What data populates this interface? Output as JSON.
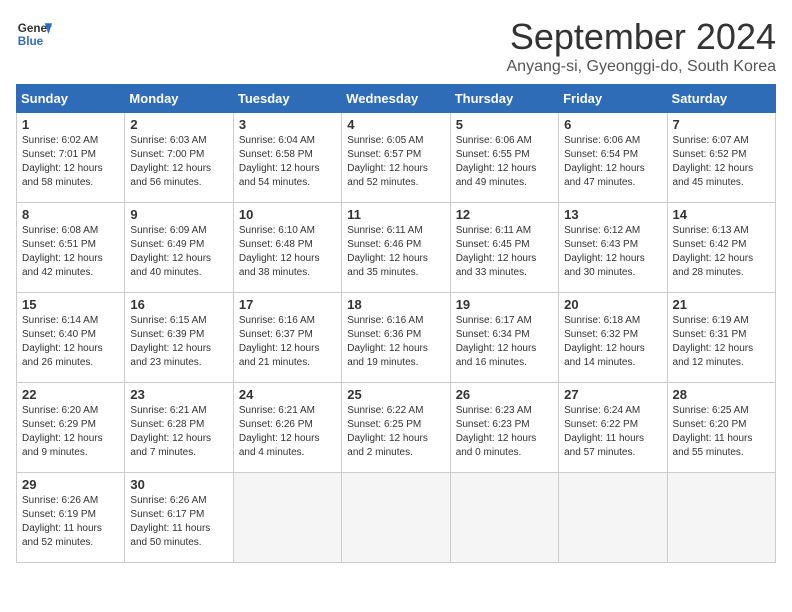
{
  "header": {
    "logo_line1": "General",
    "logo_line2": "Blue",
    "month_title": "September 2024",
    "location": "Anyang-si, Gyeonggi-do, South Korea"
  },
  "days_of_week": [
    "Sunday",
    "Monday",
    "Tuesday",
    "Wednesday",
    "Thursday",
    "Friday",
    "Saturday"
  ],
  "weeks": [
    [
      {
        "day": "1",
        "sunrise": "Sunrise: 6:02 AM",
        "sunset": "Sunset: 7:01 PM",
        "daylight": "Daylight: 12 hours and 58 minutes."
      },
      {
        "day": "2",
        "sunrise": "Sunrise: 6:03 AM",
        "sunset": "Sunset: 7:00 PM",
        "daylight": "Daylight: 12 hours and 56 minutes."
      },
      {
        "day": "3",
        "sunrise": "Sunrise: 6:04 AM",
        "sunset": "Sunset: 6:58 PM",
        "daylight": "Daylight: 12 hours and 54 minutes."
      },
      {
        "day": "4",
        "sunrise": "Sunrise: 6:05 AM",
        "sunset": "Sunset: 6:57 PM",
        "daylight": "Daylight: 12 hours and 52 minutes."
      },
      {
        "day": "5",
        "sunrise": "Sunrise: 6:06 AM",
        "sunset": "Sunset: 6:55 PM",
        "daylight": "Daylight: 12 hours and 49 minutes."
      },
      {
        "day": "6",
        "sunrise": "Sunrise: 6:06 AM",
        "sunset": "Sunset: 6:54 PM",
        "daylight": "Daylight: 12 hours and 47 minutes."
      },
      {
        "day": "7",
        "sunrise": "Sunrise: 6:07 AM",
        "sunset": "Sunset: 6:52 PM",
        "daylight": "Daylight: 12 hours and 45 minutes."
      }
    ],
    [
      {
        "day": "8",
        "sunrise": "Sunrise: 6:08 AM",
        "sunset": "Sunset: 6:51 PM",
        "daylight": "Daylight: 12 hours and 42 minutes."
      },
      {
        "day": "9",
        "sunrise": "Sunrise: 6:09 AM",
        "sunset": "Sunset: 6:49 PM",
        "daylight": "Daylight: 12 hours and 40 minutes."
      },
      {
        "day": "10",
        "sunrise": "Sunrise: 6:10 AM",
        "sunset": "Sunset: 6:48 PM",
        "daylight": "Daylight: 12 hours and 38 minutes."
      },
      {
        "day": "11",
        "sunrise": "Sunrise: 6:11 AM",
        "sunset": "Sunset: 6:46 PM",
        "daylight": "Daylight: 12 hours and 35 minutes."
      },
      {
        "day": "12",
        "sunrise": "Sunrise: 6:11 AM",
        "sunset": "Sunset: 6:45 PM",
        "daylight": "Daylight: 12 hours and 33 minutes."
      },
      {
        "day": "13",
        "sunrise": "Sunrise: 6:12 AM",
        "sunset": "Sunset: 6:43 PM",
        "daylight": "Daylight: 12 hours and 30 minutes."
      },
      {
        "day": "14",
        "sunrise": "Sunrise: 6:13 AM",
        "sunset": "Sunset: 6:42 PM",
        "daylight": "Daylight: 12 hours and 28 minutes."
      }
    ],
    [
      {
        "day": "15",
        "sunrise": "Sunrise: 6:14 AM",
        "sunset": "Sunset: 6:40 PM",
        "daylight": "Daylight: 12 hours and 26 minutes."
      },
      {
        "day": "16",
        "sunrise": "Sunrise: 6:15 AM",
        "sunset": "Sunset: 6:39 PM",
        "daylight": "Daylight: 12 hours and 23 minutes."
      },
      {
        "day": "17",
        "sunrise": "Sunrise: 6:16 AM",
        "sunset": "Sunset: 6:37 PM",
        "daylight": "Daylight: 12 hours and 21 minutes."
      },
      {
        "day": "18",
        "sunrise": "Sunrise: 6:16 AM",
        "sunset": "Sunset: 6:36 PM",
        "daylight": "Daylight: 12 hours and 19 minutes."
      },
      {
        "day": "19",
        "sunrise": "Sunrise: 6:17 AM",
        "sunset": "Sunset: 6:34 PM",
        "daylight": "Daylight: 12 hours and 16 minutes."
      },
      {
        "day": "20",
        "sunrise": "Sunrise: 6:18 AM",
        "sunset": "Sunset: 6:32 PM",
        "daylight": "Daylight: 12 hours and 14 minutes."
      },
      {
        "day": "21",
        "sunrise": "Sunrise: 6:19 AM",
        "sunset": "Sunset: 6:31 PM",
        "daylight": "Daylight: 12 hours and 12 minutes."
      }
    ],
    [
      {
        "day": "22",
        "sunrise": "Sunrise: 6:20 AM",
        "sunset": "Sunset: 6:29 PM",
        "daylight": "Daylight: 12 hours and 9 minutes."
      },
      {
        "day": "23",
        "sunrise": "Sunrise: 6:21 AM",
        "sunset": "Sunset: 6:28 PM",
        "daylight": "Daylight: 12 hours and 7 minutes."
      },
      {
        "day": "24",
        "sunrise": "Sunrise: 6:21 AM",
        "sunset": "Sunset: 6:26 PM",
        "daylight": "Daylight: 12 hours and 4 minutes."
      },
      {
        "day": "25",
        "sunrise": "Sunrise: 6:22 AM",
        "sunset": "Sunset: 6:25 PM",
        "daylight": "Daylight: 12 hours and 2 minutes."
      },
      {
        "day": "26",
        "sunrise": "Sunrise: 6:23 AM",
        "sunset": "Sunset: 6:23 PM",
        "daylight": "Daylight: 12 hours and 0 minutes."
      },
      {
        "day": "27",
        "sunrise": "Sunrise: 6:24 AM",
        "sunset": "Sunset: 6:22 PM",
        "daylight": "Daylight: 11 hours and 57 minutes."
      },
      {
        "day": "28",
        "sunrise": "Sunrise: 6:25 AM",
        "sunset": "Sunset: 6:20 PM",
        "daylight": "Daylight: 11 hours and 55 minutes."
      }
    ],
    [
      {
        "day": "29",
        "sunrise": "Sunrise: 6:26 AM",
        "sunset": "Sunset: 6:19 PM",
        "daylight": "Daylight: 11 hours and 52 minutes."
      },
      {
        "day": "30",
        "sunrise": "Sunrise: 6:26 AM",
        "sunset": "Sunset: 6:17 PM",
        "daylight": "Daylight: 11 hours and 50 minutes."
      },
      {
        "day": "",
        "sunrise": "",
        "sunset": "",
        "daylight": ""
      },
      {
        "day": "",
        "sunrise": "",
        "sunset": "",
        "daylight": ""
      },
      {
        "day": "",
        "sunrise": "",
        "sunset": "",
        "daylight": ""
      },
      {
        "day": "",
        "sunrise": "",
        "sunset": "",
        "daylight": ""
      },
      {
        "day": "",
        "sunrise": "",
        "sunset": "",
        "daylight": ""
      }
    ]
  ]
}
